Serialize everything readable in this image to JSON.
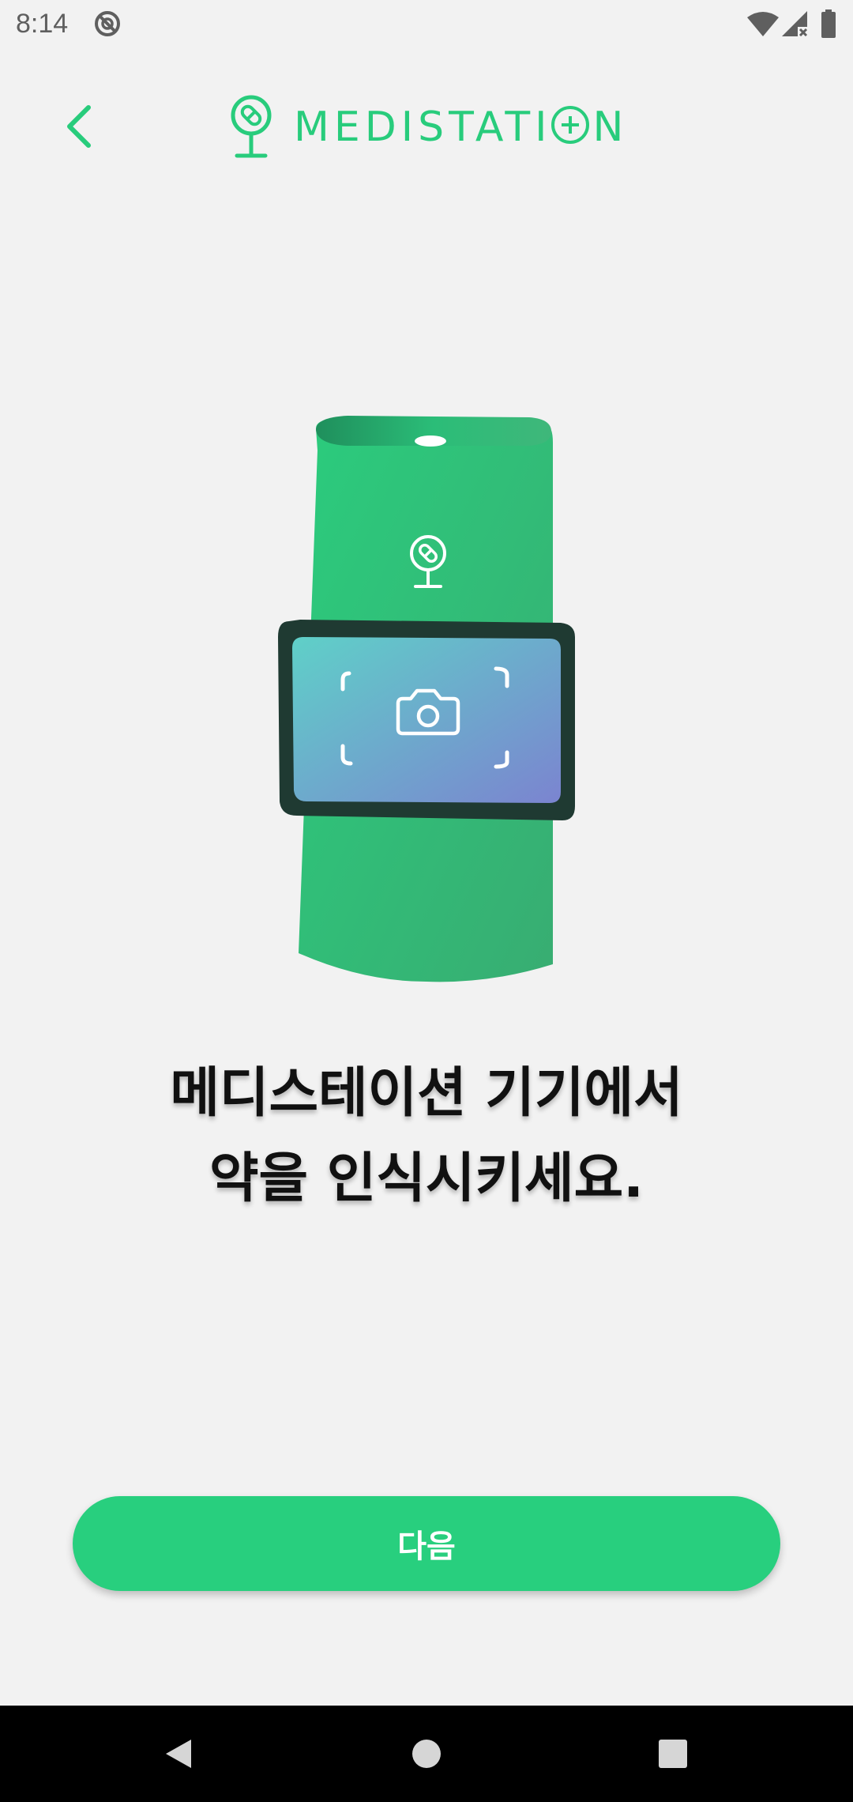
{
  "status_bar": {
    "time": "8:14",
    "icons": [
      "do-not-disturb-icon",
      "wifi-icon",
      "signal-no-data-icon",
      "battery-icon"
    ]
  },
  "header": {
    "back_icon": "chevron-left-icon",
    "logo_text_prefix": "MEDISTATI",
    "logo_text_suffix": "N",
    "logo_icon": "medistation-pin-icon"
  },
  "main": {
    "illustration": "medistation-device-camera-illustration",
    "instruction_line1": "메디스테이션 기기에서",
    "instruction_line2": "약을 인식시키세요."
  },
  "next_button": {
    "label": "다음"
  },
  "nav_bar": {
    "icons": [
      "nav-back-icon",
      "nav-home-icon",
      "nav-recents-icon"
    ]
  },
  "colors": {
    "brand_green": "#28cc7c",
    "background": "#f2f2f2",
    "text": "#111111"
  }
}
